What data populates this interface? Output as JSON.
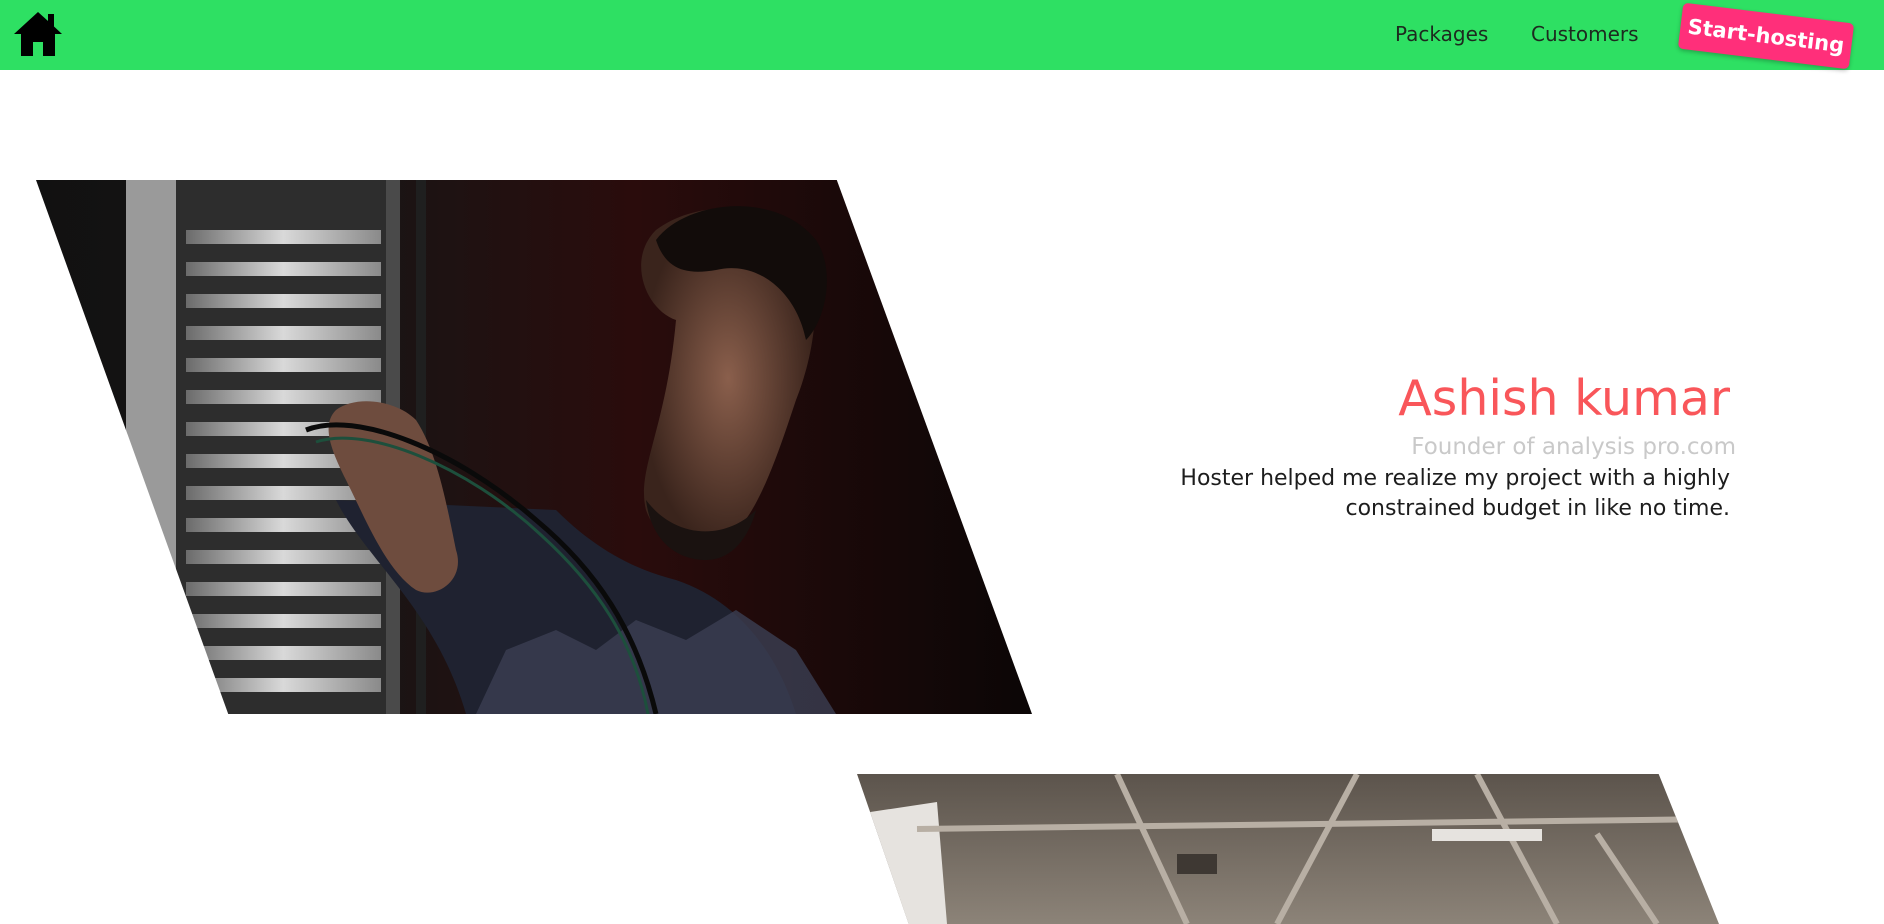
{
  "navbar": {
    "background": "#2ee063",
    "home_icon": "home-icon",
    "links": [
      {
        "label": "Packages"
      },
      {
        "label": "Customers"
      }
    ],
    "cta_label": "Start-hosting",
    "cta_color": "#ff2f7a"
  },
  "testimonials": [
    {
      "name": "Ashish kumar",
      "role": "Founder of analysis pro.com",
      "quote": "Hoster helped me realize my project with a highly constrained budget in like no time.",
      "name_color": "#f9565a",
      "image": "server-technician-photo"
    },
    {
      "image": "warehouse-photo"
    }
  ]
}
